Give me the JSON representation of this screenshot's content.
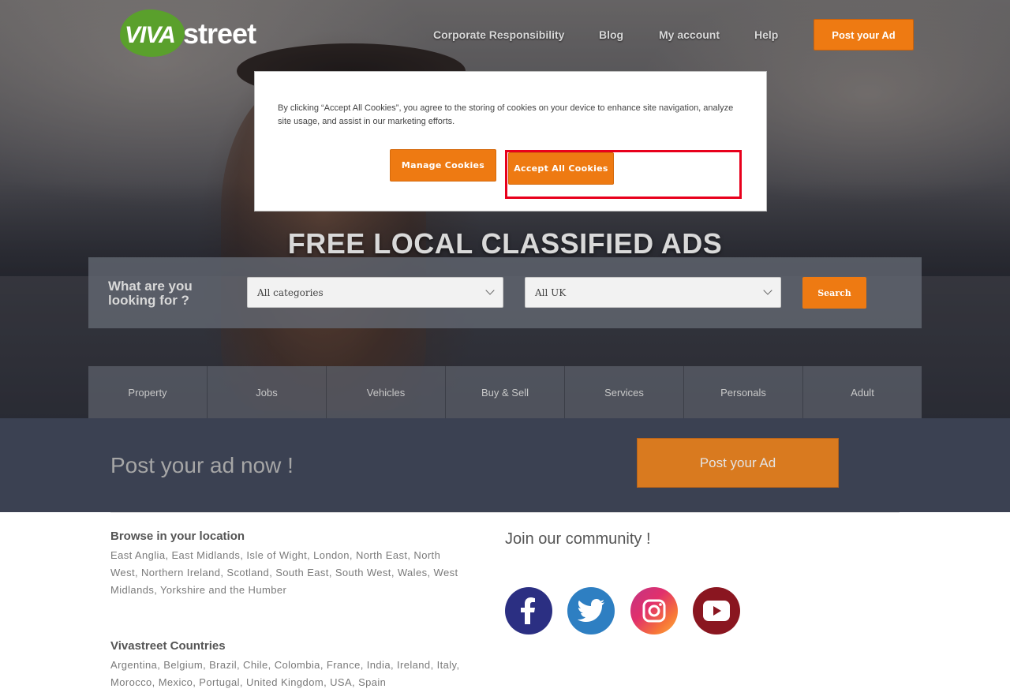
{
  "brand": {
    "logo_part1": "VIVA",
    "logo_part2": "street"
  },
  "nav": {
    "items": [
      "Corporate Responsibility",
      "Blog",
      "My account",
      "Help"
    ],
    "post_label": "Post your Ad"
  },
  "cookie_modal": {
    "text": "By clicking “Accept All Cookies”, you agree to the storing of cookies on your device to enhance site navigation, analyze site usage, and assist in our marketing efforts.",
    "manage_label": "Manage Cookies",
    "accept_label": "Accept All Cookies"
  },
  "hero": {
    "headline": "FREE LOCAL CLASSIFIED ADS",
    "search_label": "What are you looking for ?",
    "category_value": "All categories",
    "location_value": "All UK",
    "search_button": "Search"
  },
  "categories": [
    "Property",
    "Jobs",
    "Vehicles",
    "Buy & Sell",
    "Services",
    "Personals",
    "Adult"
  ],
  "post_band": {
    "text": "Post your ad now !",
    "button": "Post your Ad"
  },
  "footer": {
    "location_heading": "Browse in your location",
    "locations": [
      "East Anglia",
      "East Midlands",
      "Isle of Wight",
      "London",
      "North East",
      "North West",
      "Northern Ireland",
      "Scotland",
      "South East",
      "South West",
      "Wales",
      "West Midlands",
      "Yorkshire and the Humber"
    ],
    "countries_heading": "Vivastreet Countries",
    "countries": [
      "Argentina",
      "Belgium",
      "Brazil",
      "Chile",
      "Colombia",
      "France",
      "India",
      "Ireland",
      "Italy",
      "Morocco",
      "Mexico",
      "Portugal",
      "United Kingdom",
      "USA",
      "Spain"
    ],
    "community_heading": "Join our community !",
    "social": [
      {
        "icon": "facebook-icon",
        "color": "#2b2f82"
      },
      {
        "icon": "twitter-icon",
        "color": "#2e7fc2"
      },
      {
        "icon": "instagram-icon",
        "color": "#e2663e"
      },
      {
        "icon": "youtube-icon",
        "color": "#8a1620"
      }
    ]
  },
  "colors": {
    "accent": "#ee7a12",
    "band": "#3b4152",
    "logo_green": "#5aa02c",
    "highlight": "#e8001c"
  }
}
